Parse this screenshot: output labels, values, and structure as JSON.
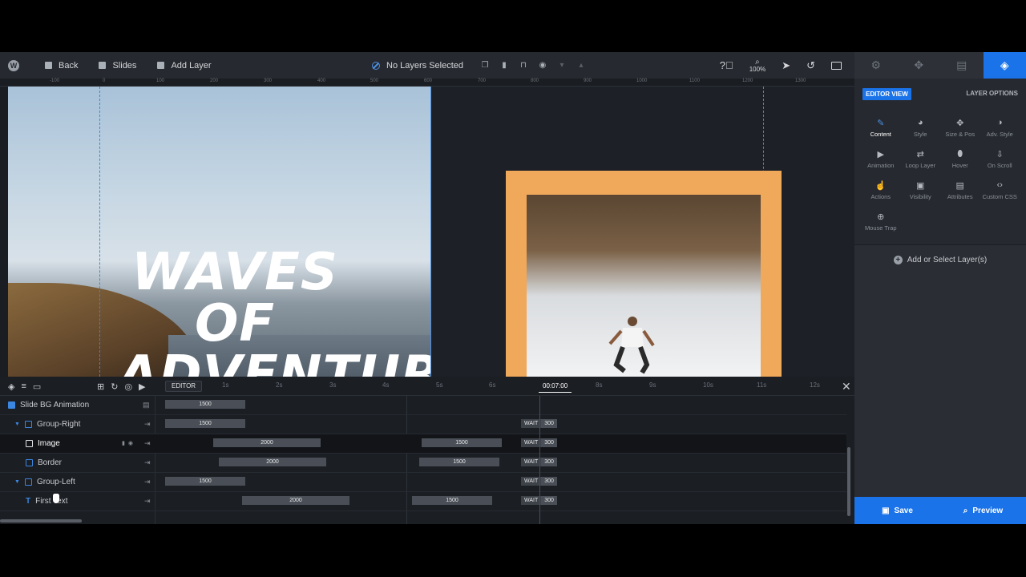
{
  "toolbar": {
    "wp_logo": "W",
    "back_label": "Back",
    "slides_label": "Slides",
    "add_layer_label": "Add Layer",
    "selection_status": "No Layers Selected",
    "zoom_level": "100%",
    "icons": [
      "wordpress-icon",
      "back-icon",
      "slides-icon",
      "add-layer-icon",
      "no-layer-icon",
      "duplicate-icon",
      "trash-icon",
      "lock-icon",
      "eye-icon",
      "help-icon",
      "zoom-icon",
      "pointer-icon",
      "undo-icon",
      "desktop-icon"
    ]
  },
  "ruler": {
    "labels": [
      "-100",
      "0",
      "100",
      "200",
      "300",
      "400",
      "500",
      "600",
      "700",
      "800",
      "900",
      "1000",
      "1100",
      "1200",
      "1300"
    ]
  },
  "canvas": {
    "headline_line1": "Waves",
    "headline_line2": "of",
    "headline_line3": "Adventure",
    "accent_color": "#f0a85a",
    "guide_color": "#3b86e0"
  },
  "timeline": {
    "editor_label": "EDITOR",
    "current_time": "00:07:00",
    "ticks": [
      "1s",
      "2s",
      "3s",
      "4s",
      "5s",
      "6s",
      "8s",
      "9s",
      "10s",
      "11s",
      "12s"
    ],
    "rows": [
      {
        "name": "Slide BG Animation",
        "bars": [
          {
            "label": "1500"
          }
        ]
      },
      {
        "name": "Group-Right",
        "bars": [
          {
            "label": "1500"
          }
        ],
        "wait_label": "WAIT",
        "wait_value": "300"
      },
      {
        "name": "Image",
        "bars": [
          {
            "label": "2000"
          },
          {
            "label": "1500"
          }
        ],
        "wait_label": "WAIT",
        "wait_value": "300"
      },
      {
        "name": "Border",
        "bars": [
          {
            "label": "2000"
          },
          {
            "label": "1500"
          }
        ],
        "wait_label": "WAIT",
        "wait_value": "300"
      },
      {
        "name": "Group-Left",
        "bars": [
          {
            "label": "1500"
          }
        ],
        "wait_label": "WAIT",
        "wait_value": "300"
      },
      {
        "name": "First Text",
        "bars": [
          {
            "label": "2000"
          },
          {
            "label": "1500"
          }
        ],
        "wait_label": "WAIT",
        "wait_value": "300"
      }
    ]
  },
  "panel": {
    "tabs": [
      "settings-icon",
      "navigation-icon",
      "media-icon",
      "layers-icon"
    ],
    "editor_view": "EDITOR VIEW",
    "layer_options": "LAYER OPTIONS",
    "options": [
      {
        "label": "Content",
        "icon": "pencil-icon",
        "glyph": "✎"
      },
      {
        "label": "Style",
        "icon": "palette-icon",
        "glyph": "◕"
      },
      {
        "label": "Size & Pos",
        "icon": "move-icon",
        "glyph": "✥"
      },
      {
        "label": "Adv. Style",
        "icon": "contrast-icon",
        "glyph": "◑"
      },
      {
        "label": "Animation",
        "icon": "play-icon",
        "glyph": "▶"
      },
      {
        "label": "Loop Layer",
        "icon": "loop-icon",
        "glyph": "⇄"
      },
      {
        "label": "Hover",
        "icon": "mouse-icon",
        "glyph": "⬮"
      },
      {
        "label": "On Scroll",
        "icon": "scroll-icon",
        "glyph": "⇩"
      },
      {
        "label": "Actions",
        "icon": "hand-icon",
        "glyph": "☝"
      },
      {
        "label": "Visibility",
        "icon": "visibility-icon",
        "glyph": "▣"
      },
      {
        "label": "Attributes",
        "icon": "file-icon",
        "glyph": "▤"
      },
      {
        "label": "Custom CSS",
        "icon": "code-icon",
        "glyph": "‹›"
      },
      {
        "label": "Mouse Trap",
        "icon": "crosshair-icon",
        "glyph": "⊕"
      }
    ],
    "add_or_select": "Add or Select Layer(s)",
    "save_label": "Save",
    "preview_label": "Preview"
  }
}
